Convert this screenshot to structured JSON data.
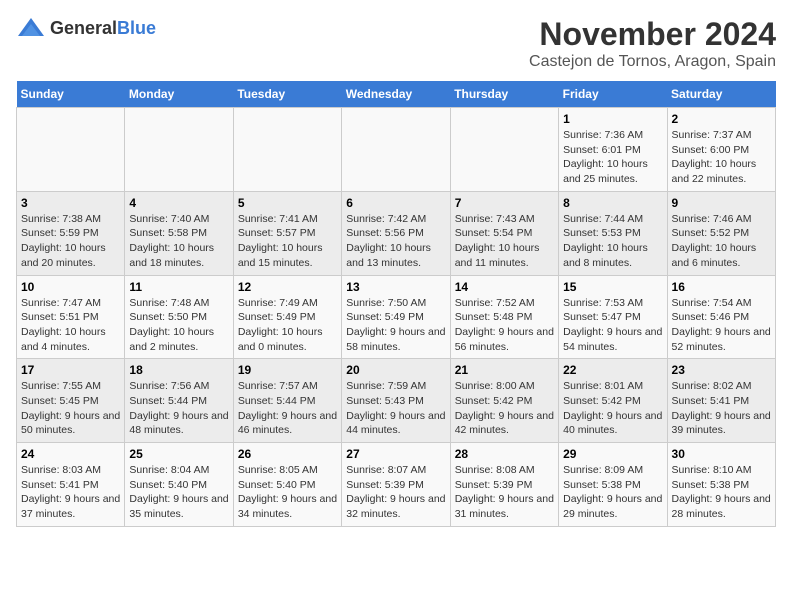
{
  "logo": {
    "general": "General",
    "blue": "Blue"
  },
  "header": {
    "month": "November 2024",
    "location": "Castejon de Tornos, Aragon, Spain"
  },
  "weekdays": [
    "Sunday",
    "Monday",
    "Tuesday",
    "Wednesday",
    "Thursday",
    "Friday",
    "Saturday"
  ],
  "weeks": [
    [
      {
        "day": "",
        "info": ""
      },
      {
        "day": "",
        "info": ""
      },
      {
        "day": "",
        "info": ""
      },
      {
        "day": "",
        "info": ""
      },
      {
        "day": "",
        "info": ""
      },
      {
        "day": "1",
        "info": "Sunrise: 7:36 AM\nSunset: 6:01 PM\nDaylight: 10 hours and 25 minutes."
      },
      {
        "day": "2",
        "info": "Sunrise: 7:37 AM\nSunset: 6:00 PM\nDaylight: 10 hours and 22 minutes."
      }
    ],
    [
      {
        "day": "3",
        "info": "Sunrise: 7:38 AM\nSunset: 5:59 PM\nDaylight: 10 hours and 20 minutes."
      },
      {
        "day": "4",
        "info": "Sunrise: 7:40 AM\nSunset: 5:58 PM\nDaylight: 10 hours and 18 minutes."
      },
      {
        "day": "5",
        "info": "Sunrise: 7:41 AM\nSunset: 5:57 PM\nDaylight: 10 hours and 15 minutes."
      },
      {
        "day": "6",
        "info": "Sunrise: 7:42 AM\nSunset: 5:56 PM\nDaylight: 10 hours and 13 minutes."
      },
      {
        "day": "7",
        "info": "Sunrise: 7:43 AM\nSunset: 5:54 PM\nDaylight: 10 hours and 11 minutes."
      },
      {
        "day": "8",
        "info": "Sunrise: 7:44 AM\nSunset: 5:53 PM\nDaylight: 10 hours and 8 minutes."
      },
      {
        "day": "9",
        "info": "Sunrise: 7:46 AM\nSunset: 5:52 PM\nDaylight: 10 hours and 6 minutes."
      }
    ],
    [
      {
        "day": "10",
        "info": "Sunrise: 7:47 AM\nSunset: 5:51 PM\nDaylight: 10 hours and 4 minutes."
      },
      {
        "day": "11",
        "info": "Sunrise: 7:48 AM\nSunset: 5:50 PM\nDaylight: 10 hours and 2 minutes."
      },
      {
        "day": "12",
        "info": "Sunrise: 7:49 AM\nSunset: 5:49 PM\nDaylight: 10 hours and 0 minutes."
      },
      {
        "day": "13",
        "info": "Sunrise: 7:50 AM\nSunset: 5:49 PM\nDaylight: 9 hours and 58 minutes."
      },
      {
        "day": "14",
        "info": "Sunrise: 7:52 AM\nSunset: 5:48 PM\nDaylight: 9 hours and 56 minutes."
      },
      {
        "day": "15",
        "info": "Sunrise: 7:53 AM\nSunset: 5:47 PM\nDaylight: 9 hours and 54 minutes."
      },
      {
        "day": "16",
        "info": "Sunrise: 7:54 AM\nSunset: 5:46 PM\nDaylight: 9 hours and 52 minutes."
      }
    ],
    [
      {
        "day": "17",
        "info": "Sunrise: 7:55 AM\nSunset: 5:45 PM\nDaylight: 9 hours and 50 minutes."
      },
      {
        "day": "18",
        "info": "Sunrise: 7:56 AM\nSunset: 5:44 PM\nDaylight: 9 hours and 48 minutes."
      },
      {
        "day": "19",
        "info": "Sunrise: 7:57 AM\nSunset: 5:44 PM\nDaylight: 9 hours and 46 minutes."
      },
      {
        "day": "20",
        "info": "Sunrise: 7:59 AM\nSunset: 5:43 PM\nDaylight: 9 hours and 44 minutes."
      },
      {
        "day": "21",
        "info": "Sunrise: 8:00 AM\nSunset: 5:42 PM\nDaylight: 9 hours and 42 minutes."
      },
      {
        "day": "22",
        "info": "Sunrise: 8:01 AM\nSunset: 5:42 PM\nDaylight: 9 hours and 40 minutes."
      },
      {
        "day": "23",
        "info": "Sunrise: 8:02 AM\nSunset: 5:41 PM\nDaylight: 9 hours and 39 minutes."
      }
    ],
    [
      {
        "day": "24",
        "info": "Sunrise: 8:03 AM\nSunset: 5:41 PM\nDaylight: 9 hours and 37 minutes."
      },
      {
        "day": "25",
        "info": "Sunrise: 8:04 AM\nSunset: 5:40 PM\nDaylight: 9 hours and 35 minutes."
      },
      {
        "day": "26",
        "info": "Sunrise: 8:05 AM\nSunset: 5:40 PM\nDaylight: 9 hours and 34 minutes."
      },
      {
        "day": "27",
        "info": "Sunrise: 8:07 AM\nSunset: 5:39 PM\nDaylight: 9 hours and 32 minutes."
      },
      {
        "day": "28",
        "info": "Sunrise: 8:08 AM\nSunset: 5:39 PM\nDaylight: 9 hours and 31 minutes."
      },
      {
        "day": "29",
        "info": "Sunrise: 8:09 AM\nSunset: 5:38 PM\nDaylight: 9 hours and 29 minutes."
      },
      {
        "day": "30",
        "info": "Sunrise: 8:10 AM\nSunset: 5:38 PM\nDaylight: 9 hours and 28 minutes."
      }
    ]
  ]
}
